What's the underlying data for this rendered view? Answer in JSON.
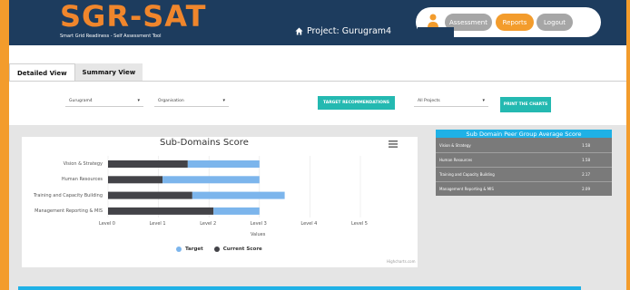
{
  "header": {
    "logo_title": "SGR-SAT",
    "logo_subtitle": "Smart Grid Readiness - Self Assessment Tool",
    "project_label": "Project: Gurugram4",
    "nav": {
      "assessment": "Assessment",
      "reports": "Reports",
      "logout": "Logout"
    }
  },
  "tabs": [
    {
      "label": "Detailed View",
      "active": true
    },
    {
      "label": "Summary View",
      "active": false
    }
  ],
  "filters": {
    "city": "Gurugram4",
    "type": "Organisation",
    "projects": "All Projects",
    "target_button": "TARGET RECOMMENDATIONS",
    "print_button": "PRINT THE CHARTS",
    "arrow": "▾"
  },
  "chart_data": {
    "type": "bar",
    "orientation": "horizontal",
    "stacked": true,
    "title": "Sub-Domains Score",
    "xlabel": "Values",
    "xlim": [
      0,
      5
    ],
    "categories": [
      "Vision & Strategy",
      "Human Resources",
      "Training and Capacity Building",
      "Management Reporting & MIS"
    ],
    "x_ticks": [
      "Level 0",
      "Level 1",
      "Level 2",
      "Level 3",
      "Level 4",
      "Level 5"
    ],
    "series": [
      {
        "name": "Target",
        "values": [
          1.42,
          1.92,
          1.83,
          0.91
        ],
        "color": "#7cb5ec"
      },
      {
        "name": "Current Score",
        "values": [
          1.58,
          1.08,
          1.67,
          2.09
        ],
        "color": "#434348"
      }
    ],
    "legend_position": "bottom",
    "credits": "Highcharts.com"
  },
  "peer_table": {
    "title": "Sub Domain Peer Group Average Score",
    "rows": [
      {
        "label": "Vision & Strategy",
        "value": "1.58"
      },
      {
        "label": "Human Resources",
        "value": "1.58"
      },
      {
        "label": "Training and Capacity Building",
        "value": "2.17"
      },
      {
        "label": "Management Reporting & MIS",
        "value": "2.09"
      }
    ]
  },
  "colors": {
    "header": "#1d3c5e",
    "accent_orange": "#f39c2c",
    "teal_button": "#24b9b1",
    "cyan_header": "#1fb1e6"
  }
}
